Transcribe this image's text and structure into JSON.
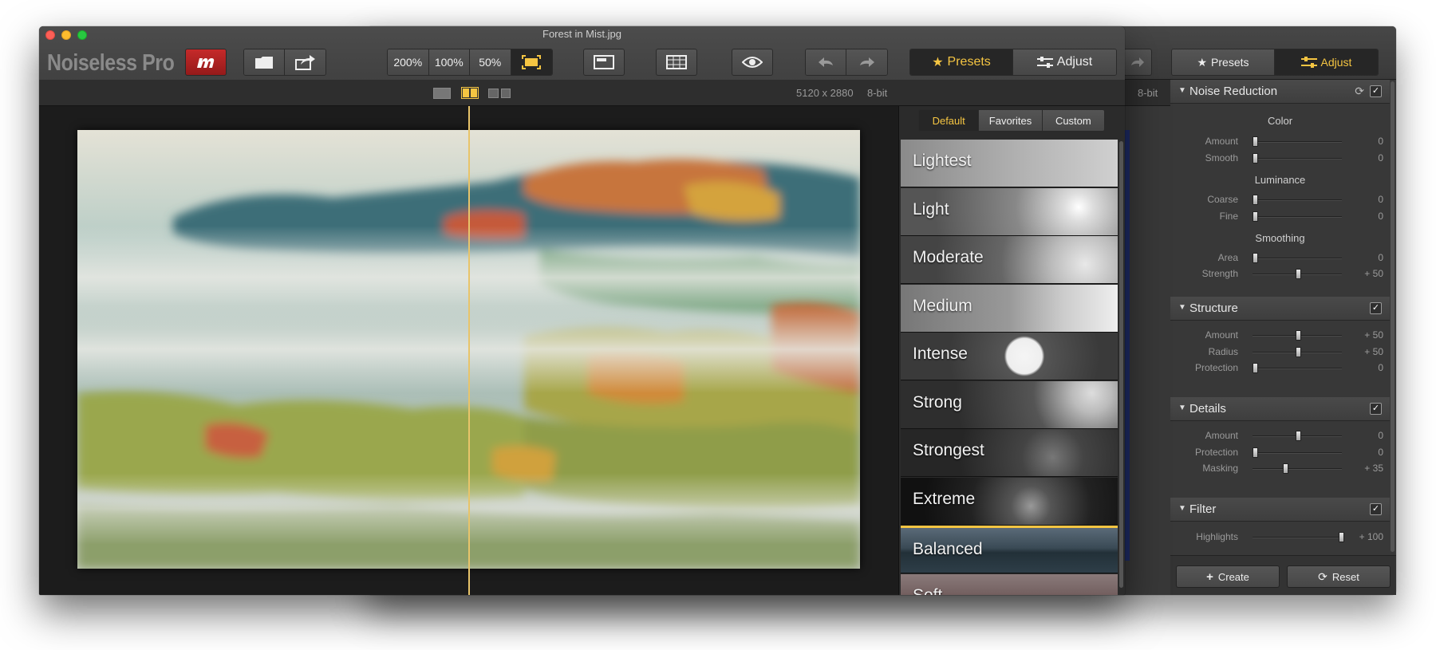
{
  "window": {
    "title": "Forest in Mist.jpg"
  },
  "app": {
    "name": "Noiseless Pro"
  },
  "toolbar": {
    "zoom_options": [
      "200%",
      "100%",
      "50%"
    ],
    "active_zoom": "fit",
    "tabs": {
      "presets": "Presets",
      "adjust": "Adjust"
    }
  },
  "info": {
    "dimensions": "5120 x 2880",
    "bit_depth": "8-bit"
  },
  "preset_tabs": [
    "Default",
    "Favorites",
    "Custom"
  ],
  "presets": [
    {
      "label": "Lightest"
    },
    {
      "label": "Light"
    },
    {
      "label": "Moderate"
    },
    {
      "label": "Medium"
    },
    {
      "label": "Intense"
    },
    {
      "label": "Strong"
    },
    {
      "label": "Strongest"
    },
    {
      "label": "Extreme"
    },
    {
      "label": "Balanced",
      "selected": true
    },
    {
      "label": "Soft"
    }
  ],
  "adjust": {
    "noise_reduction": {
      "title": "Noise Reduction",
      "groups": {
        "color": "Color",
        "luminance": "Luminance",
        "smoothing": "Smoothing"
      },
      "color": [
        {
          "label": "Amount",
          "value": "0",
          "level": 0
        },
        {
          "label": "Smooth",
          "value": "0",
          "level": 0
        }
      ],
      "luminance": [
        {
          "label": "Coarse",
          "value": "0",
          "level": 0
        },
        {
          "label": "Fine",
          "value": "0",
          "level": 0
        }
      ],
      "smoothing": [
        {
          "label": "Area",
          "value": "0",
          "level": 0
        },
        {
          "label": "Strength",
          "value": "+ 50",
          "level": 0.5
        }
      ]
    },
    "structure": {
      "title": "Structure",
      "rows": [
        {
          "label": "Amount",
          "value": "+ 50",
          "level": 0.5
        },
        {
          "label": "Radius",
          "value": "+ 50",
          "level": 0.5
        },
        {
          "label": "Protection",
          "value": "0",
          "level": 0
        }
      ]
    },
    "details": {
      "title": "Details",
      "rows": [
        {
          "label": "Amount",
          "value": "0",
          "level": 0.5
        },
        {
          "label": "Protection",
          "value": "0",
          "level": 0
        },
        {
          "label": "Masking",
          "value": "+ 35",
          "level": 0.35
        }
      ]
    },
    "filter": {
      "title": "Filter",
      "rows": [
        {
          "label": "Highlights",
          "value": "+ 100",
          "level": 1
        }
      ]
    },
    "buttons": {
      "create": "Create",
      "reset": "Reset"
    }
  },
  "colors": {
    "accent": "#f5c542",
    "divider": "#e8c46a"
  }
}
